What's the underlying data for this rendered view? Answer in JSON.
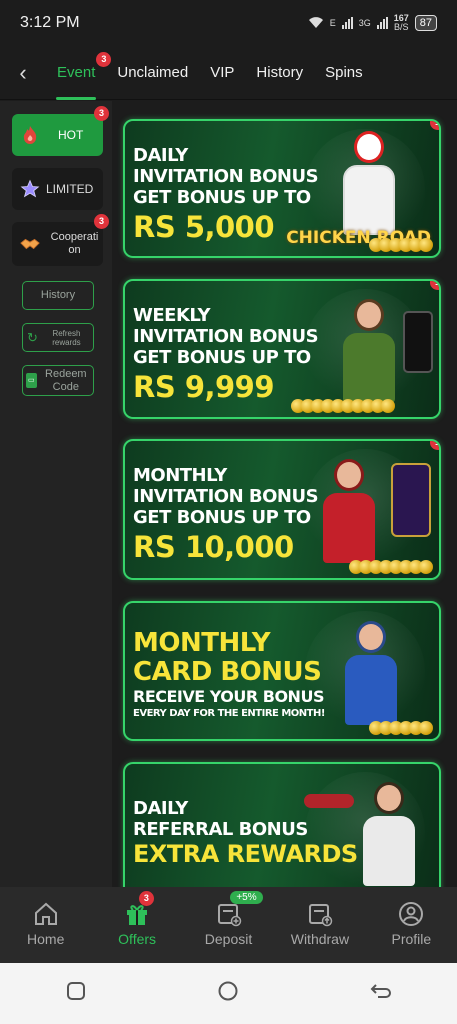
{
  "status_bar": {
    "time": "3:12 PM",
    "network_e": "E",
    "network_3g": "3G",
    "speed": "167",
    "speed_unit": "B/S",
    "battery": "87"
  },
  "tabs": [
    {
      "label": "Event",
      "active": true,
      "badge": "3"
    },
    {
      "label": "Unclaimed"
    },
    {
      "label": "VIP"
    },
    {
      "label": "History"
    },
    {
      "label": "Spins"
    }
  ],
  "sidebar": {
    "categories": [
      {
        "label": "HOT",
        "icon": "flame-icon",
        "badge": "3",
        "active": true
      },
      {
        "label": "LIMITED",
        "icon": "star-icon"
      },
      {
        "label": "Cooperati on",
        "icon": "handshake-icon",
        "badge": "3"
      }
    ],
    "history_label": "History",
    "refresh_label": "Refresh rewards",
    "redeem_label": "Redeem Code"
  },
  "banners": [
    {
      "line1": "DAILY",
      "line2": "INVITATION BONUS",
      "line3": "GET BONUS UP TO",
      "amount": "RS 5,000",
      "logo": "CHICKEN ROAD",
      "badge": "1"
    },
    {
      "line1": "WEEKLY",
      "line2": "INVITATION BONUS",
      "line3": "GET BONUS UP TO",
      "amount": "RS 9,999",
      "badge": "1"
    },
    {
      "line1": "MONTHLY",
      "line2": "INVITATION BONUS",
      "line3": "GET BONUS UP TO",
      "amount": "RS 10,000",
      "badge": "1"
    },
    {
      "line1": "MONTHLY",
      "line2": "CARD BONUS",
      "line3": "RECEIVE YOUR BONUS",
      "line4": "EVERY DAY FOR THE ENTIRE MONTH!"
    },
    {
      "line1": "DAILY",
      "line2": "REFERRAL BONUS",
      "line3": "EXTRA REWARDS"
    }
  ],
  "bottom_nav": [
    {
      "label": "Home",
      "icon": "home-icon"
    },
    {
      "label": "Offers",
      "icon": "gift-icon",
      "badge": "3",
      "active": true
    },
    {
      "label": "Deposit",
      "icon": "deposit-icon",
      "pill": "+5%"
    },
    {
      "label": "Withdraw",
      "icon": "withdraw-icon"
    },
    {
      "label": "Profile",
      "icon": "profile-icon"
    }
  ],
  "colors": {
    "accent": "#2ec05a",
    "badge": "#e0333b",
    "gold_text": "#f7e43a",
    "background": "#1c1c1c"
  }
}
